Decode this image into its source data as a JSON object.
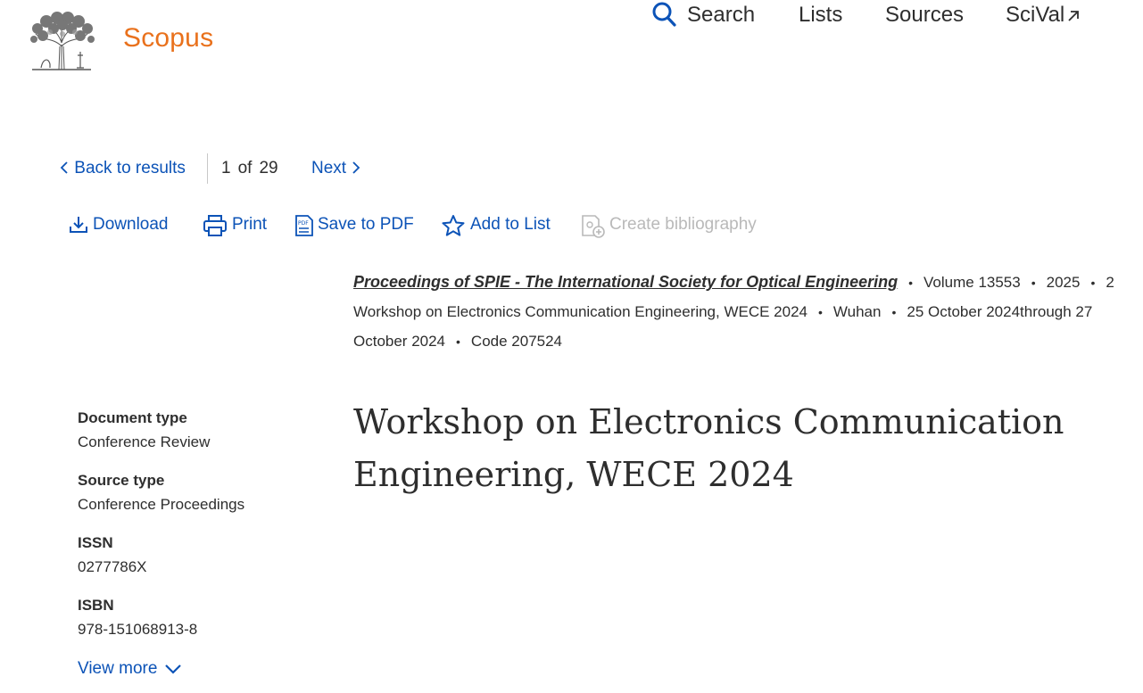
{
  "header": {
    "brand": "Scopus",
    "nav": {
      "search": "Search",
      "lists": "Lists",
      "sources": "Sources",
      "scival": "SciVal"
    }
  },
  "result_nav": {
    "back": "Back to results",
    "current": "1",
    "of": "of",
    "total": "29",
    "next": "Next"
  },
  "toolbar": {
    "download": "Download",
    "print": "Print",
    "save_pdf": "Save to PDF",
    "add_list": "Add to List",
    "bibliography": "Create bibliography",
    "pdf_icon_text": "PDF"
  },
  "source": {
    "journal": "Proceedings of SPIE - The International Society for Optical Engineering",
    "volume": "Volume 13553",
    "year": "2025",
    "year_tail": "2",
    "conference": "Workshop on Electronics Communication Engineering, WECE 2024",
    "location": "Wuhan",
    "dates_line1": "25 October 2024through 27",
    "dates_line2": "October 2024",
    "code": "Code 207524"
  },
  "document": {
    "title_line1": "Workshop on Electronics Communication",
    "title_line2": "Engineering, WECE 2024"
  },
  "metadata": [
    {
      "label": "Document type",
      "value": "Conference Review"
    },
    {
      "label": "Source type",
      "value": "Conference Proceedings"
    },
    {
      "label": "ISSN",
      "value": "0277786X"
    },
    {
      "label": "ISBN",
      "value": "978-151068913-8"
    }
  ],
  "view_more": "View more",
  "colors": {
    "brand": "#e9711c",
    "link": "#0c53b7",
    "text": "#2e2e2e",
    "disabled": "#b9b9b9"
  }
}
